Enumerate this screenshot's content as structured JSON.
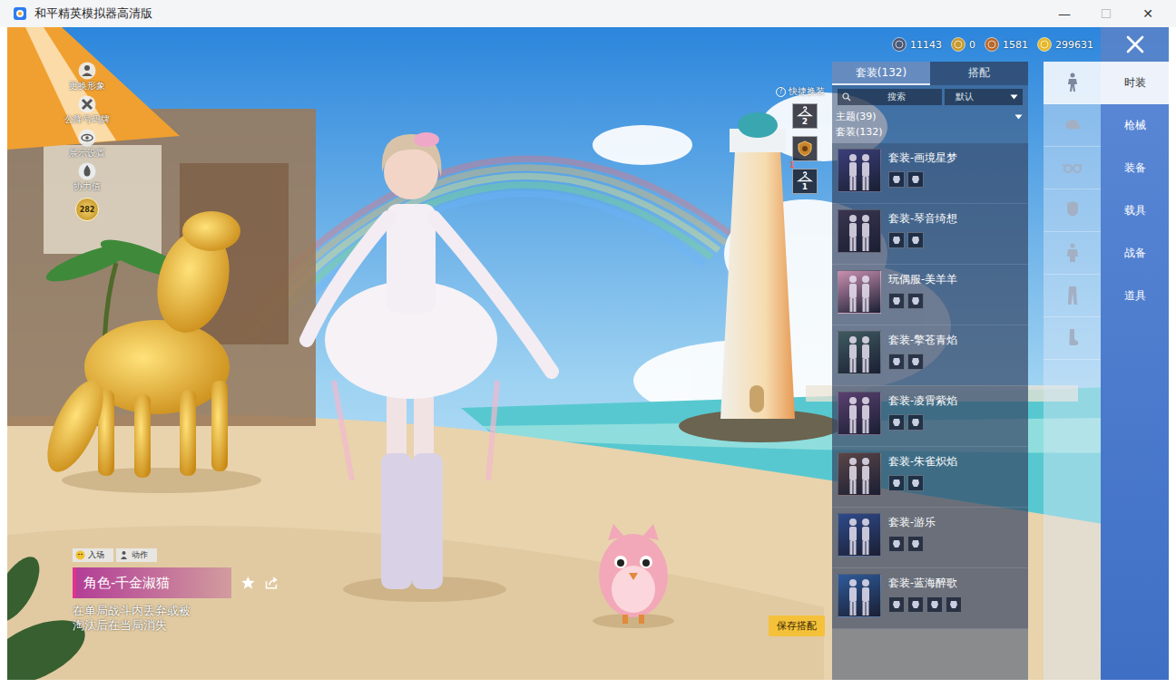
{
  "window": {
    "title": "和平精英模拟器高清版",
    "controls": [
      {
        "label": "—",
        "disabled": false
      },
      {
        "label": "☐",
        "disabled": true
      },
      {
        "label": "✕",
        "disabled": false
      }
    ]
  },
  "side_actions": [
    {
      "label": "更换形象",
      "kind": "avatar"
    },
    {
      "label": "公降号码牌",
      "kind": "plate"
    },
    {
      "label": "展示设置",
      "kind": "eye"
    },
    {
      "label": "协力值",
      "kind": "flame"
    }
  ],
  "level_badge": "282",
  "currencies": [
    {
      "amount": "11143",
      "color": "#4a5878"
    },
    {
      "amount": "0",
      "color": "#c89a2e"
    },
    {
      "amount": "1581",
      "color": "#b8692c"
    },
    {
      "amount": "299631",
      "color": "#e8b828"
    }
  ],
  "quick_outfit": {
    "label": "快捷换装",
    "help": "?",
    "slots": [
      {
        "kind": "hanger",
        "label": "2"
      },
      {
        "kind": "emblem"
      },
      {
        "kind": "hanger",
        "label": "1",
        "badge": "1"
      }
    ]
  },
  "outfit_panel": {
    "tabs": [
      {
        "label": "套装(132)",
        "selected": true
      },
      {
        "label": "搭配",
        "selected": false
      }
    ],
    "search": {
      "placeholder": "搜索"
    },
    "sort": {
      "value": "默认"
    },
    "theme_filter": {
      "label": "主题(39)",
      "expanded": false
    },
    "category_label": "套装(132)",
    "items": [
      {
        "name": "套装-画境星梦",
        "parts": 2,
        "color": "#3b3f7a"
      },
      {
        "name": "套装-琴音绮想",
        "parts": 2,
        "color": "#3a3550"
      },
      {
        "name": "玩偶服-美羊羊",
        "parts": 2,
        "color": "#c98fb0"
      },
      {
        "name": "套装-擎苍青焰",
        "parts": 2,
        "color": "#3f5a60"
      },
      {
        "name": "套装-凌霄紫焰",
        "parts": 2,
        "color": "#5a4070"
      },
      {
        "name": "套装-朱雀炽焰",
        "parts": 2,
        "color": "#5a4548"
      },
      {
        "name": "套装-游乐",
        "parts": 2,
        "color": "#2f4a8a"
      },
      {
        "name": "套装-蓝海醉歌",
        "parts": 4,
        "color": "#2e5a9a"
      }
    ]
  },
  "category_icons": [
    {
      "kind": "outfit",
      "selected": true
    },
    {
      "kind": "hat",
      "selected": false
    },
    {
      "kind": "glasses",
      "selected": false
    },
    {
      "kind": "mask",
      "selected": false
    },
    {
      "kind": "top",
      "selected": false
    },
    {
      "kind": "pants",
      "selected": false
    },
    {
      "kind": "socks",
      "selected": false
    }
  ],
  "menu": [
    {
      "label": "时装",
      "selected": true
    },
    {
      "label": "枪械",
      "selected": false
    },
    {
      "label": "装备",
      "selected": false
    },
    {
      "label": "载具",
      "selected": false
    },
    {
      "label": "战备",
      "selected": false
    },
    {
      "label": "道具",
      "selected": false
    }
  ],
  "character": {
    "tabs": [
      {
        "label": "入场",
        "kind": "face"
      },
      {
        "label": "动作",
        "kind": "pose"
      }
    ],
    "name": "角色-千金淑猫",
    "favorite": false,
    "description": "在单局战斗内丢弃或被淘汰后在当局消失"
  },
  "save_button": {
    "label": "保存搭配"
  }
}
